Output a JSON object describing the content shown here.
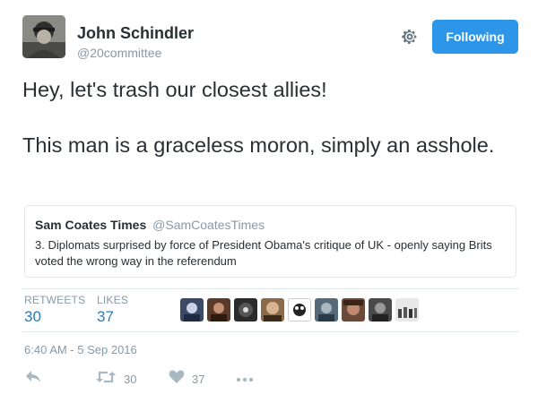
{
  "author": {
    "name": "John Schindler",
    "handle": "@20committee",
    "avatar_icon": "profile-photo"
  },
  "header": {
    "settings_icon": "gear-icon",
    "follow_button_label": "Following",
    "follow_button_color": "#2d96e8"
  },
  "tweet": {
    "line1": "Hey, let's trash our closest allies!",
    "line2": "This man is a graceless moron, simply an asshole."
  },
  "quoted_tweet": {
    "name": "Sam Coates Times",
    "handle": "@SamCoatesTimes",
    "text": "3. Diplomats surprised by force of President Obama's critique of UK - openly saying Brits voted the wrong way in the referendum"
  },
  "stats": {
    "retweets_label": "RETWEETS",
    "retweets_value": "30",
    "likes_label": "LIKES",
    "likes_value": "37",
    "liker_avatars_count_shown": 9
  },
  "timestamp": "6:40 AM - 5 Sep 2016",
  "actions": {
    "reply_icon": "reply-icon",
    "retweet_icon": "retweet-icon",
    "retweet_count": "30",
    "like_icon": "heart-icon",
    "like_count": "37",
    "more_icon": "more-icon"
  },
  "colors": {
    "accent_blue": "#2b7bb9",
    "muted_gray": "#8899a6",
    "text": "#292f33",
    "border": "#e1e8ed"
  }
}
